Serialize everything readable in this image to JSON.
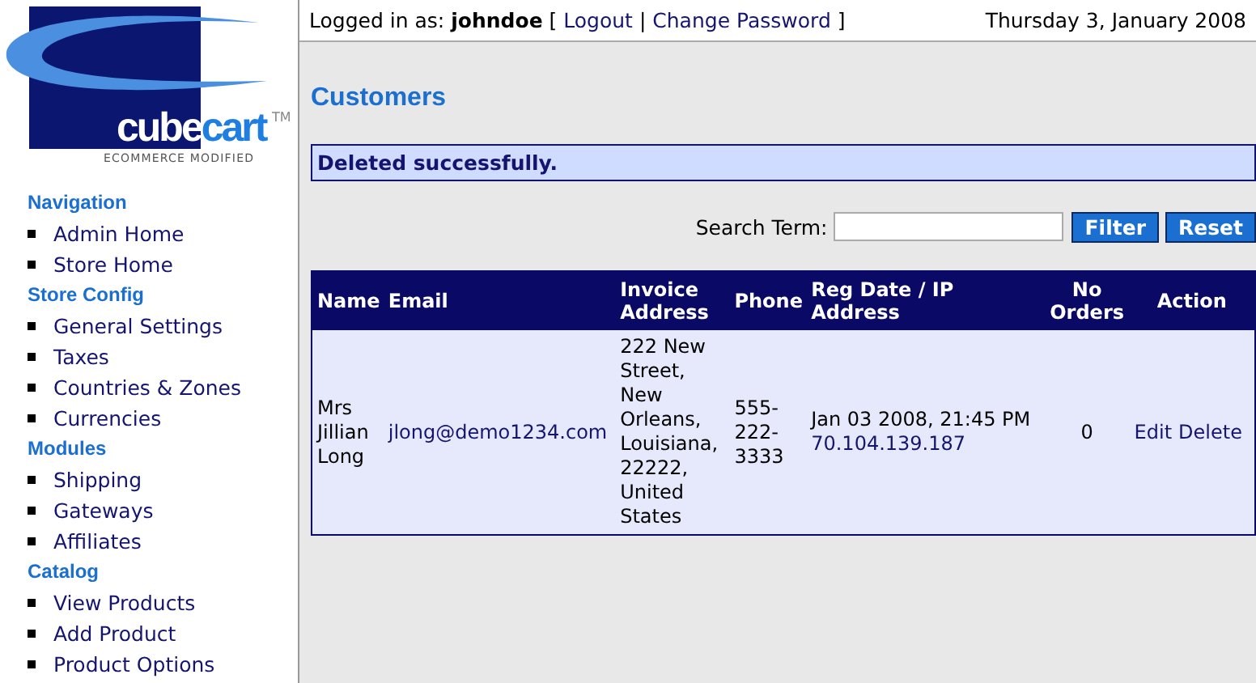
{
  "logo": {
    "word_a": "cube",
    "word_b": "cart",
    "tm": "TM",
    "tagline": "ECOMMERCE MODIFIED"
  },
  "header": {
    "user_label": "Logged in as:",
    "username": "johndoe",
    "links": [
      "Logout",
      "Change Password"
    ],
    "bracket_open": "[",
    "separator": "|",
    "bracket_close": "]",
    "date": "Thursday 3, January 2008"
  },
  "sidebar": {
    "sections": [
      {
        "title": "Navigation",
        "items": [
          "Admin Home",
          "Store Home"
        ]
      },
      {
        "title": "Store Config",
        "items": [
          "General Settings",
          "Taxes",
          "Countries & Zones",
          "Currencies"
        ]
      },
      {
        "title": "Modules",
        "items": [
          "Shipping",
          "Gateways",
          "Affiliates"
        ]
      },
      {
        "title": "Catalog",
        "items": [
          "View Products",
          "Add Product",
          "Product Options"
        ]
      }
    ]
  },
  "page_title": "Customers",
  "message": "Deleted successfully.",
  "search": {
    "label": "Search Term:",
    "buttons": [
      "Filter",
      "Reset"
    ]
  },
  "table": {
    "columns": [
      "Name",
      "Email",
      "Invoice Address",
      "Phone",
      "Reg Date / IP Address",
      "No Orders",
      "Action"
    ],
    "rows": [
      {
        "name": "Mrs Jillian Long",
        "email": "jlong@demo1234.com",
        "invoice_address": "222 New Street, New Orleans, Louisiana, 22222, United States",
        "phone": "555-222-3333",
        "reg_date": "Jan 03 2008, 21:45 PM",
        "ip_address": "70.104.139.187",
        "orders": "0",
        "actions": [
          "Edit",
          "Delete"
        ]
      }
    ]
  }
}
